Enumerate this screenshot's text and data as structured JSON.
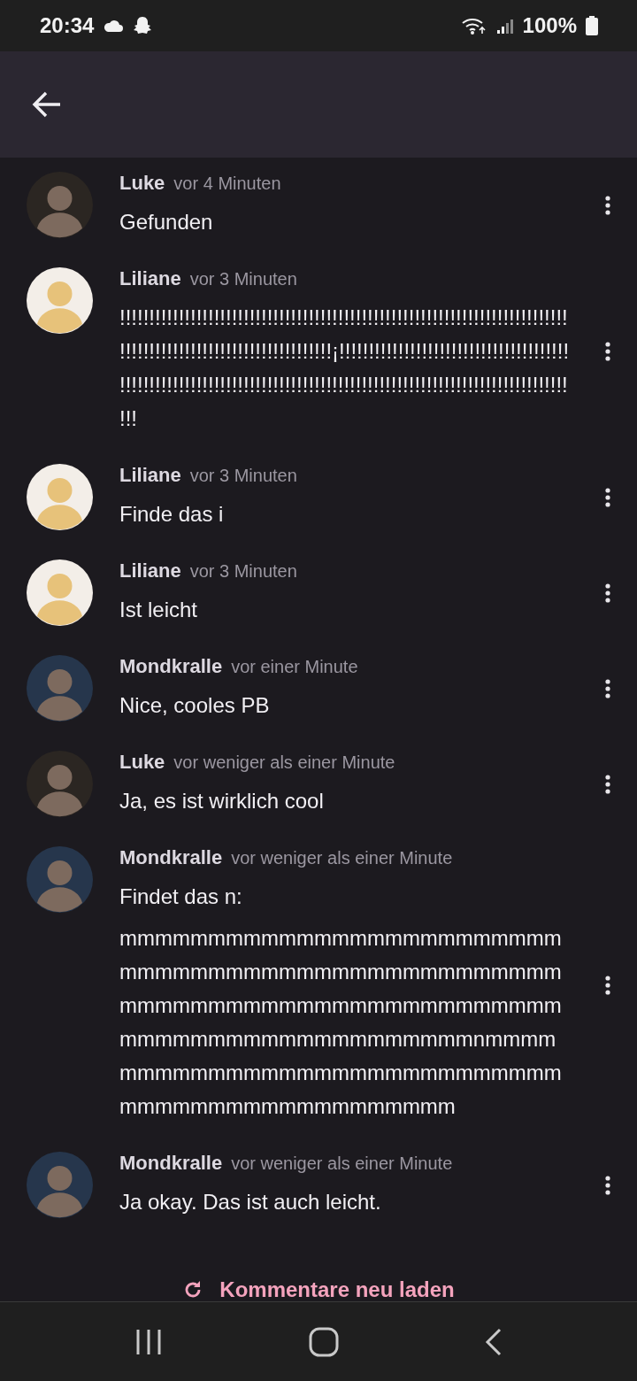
{
  "status_bar": {
    "time": "20:34",
    "battery": "100%"
  },
  "comments": [
    {
      "author": "Luke",
      "time": "vor 4 Minuten",
      "color": "#2b2622",
      "lines": [
        "Gefunden"
      ]
    },
    {
      "author": "Liliane",
      "time": "vor 3 Minuten",
      "color": "#f3eee8",
      "lines": [
        "!!!!!!!!!!!!!!!!!!!!!!!!!!!!!!!!!!!!!!!!!!!!!!!!!!!!!!!!!!!!!!!!!!!!!!!!!!!!",
        "!!!!!!!!!!!!!!!!!!!!!!!!!!!!!!!!!!!!¡!!!!!!!!!!!!!!!!!!!!!!!!!!!!!!!!!!!!!!!",
        "!!!!!!!!!!!!!!!!!!!!!!!!!!!!!!!!!!!!!!!!!!!!!!!!!!!!!!!!!!!!!!!!!!!!!!!!!!!!",
        "!!!"
      ]
    },
    {
      "author": "Liliane",
      "time": "vor 3 Minuten",
      "color": "#f3eee8",
      "lines": [
        "Finde das i"
      ]
    },
    {
      "author": "Liliane",
      "time": "vor 3 Minuten",
      "color": "#f3eee8",
      "lines": [
        "Ist leicht"
      ]
    },
    {
      "author": "Mondkralle",
      "time": "vor einer Minute",
      "color": "#26364c",
      "lines": [
        "Nice, cooles PB"
      ]
    },
    {
      "author": "Luke",
      "time": "vor weniger als einer Minute",
      "color": "#2b2622",
      "lines": [
        "Ja, es ist wirklich cool"
      ]
    },
    {
      "author": "Mondkralle",
      "time": "vor weniger als einer Minute",
      "color": "#26364c",
      "lines": [
        "Findet das n:",
        "mmmmmmmmmmmmmmmmmmmmmmmmm",
        "mmmmmmmmmmmmmmmmmmmmmmmmm",
        "mmmmmmmmmmmmmmmmmmmmmmmmm",
        "mmmmmmmmmmmmmmmmmmmmnmmmm",
        "mmmmmmmmmmmmmmmmmmmmmmmmm",
        "mmmmmmmmmmmmmmmmmmm"
      ]
    },
    {
      "author": "Mondkralle",
      "time": "vor weniger als einer Minute",
      "color": "#26364c",
      "lines": [
        "Ja okay. Das ist auch leicht."
      ]
    }
  ],
  "reload": {
    "label": "Kommentare neu laden"
  }
}
